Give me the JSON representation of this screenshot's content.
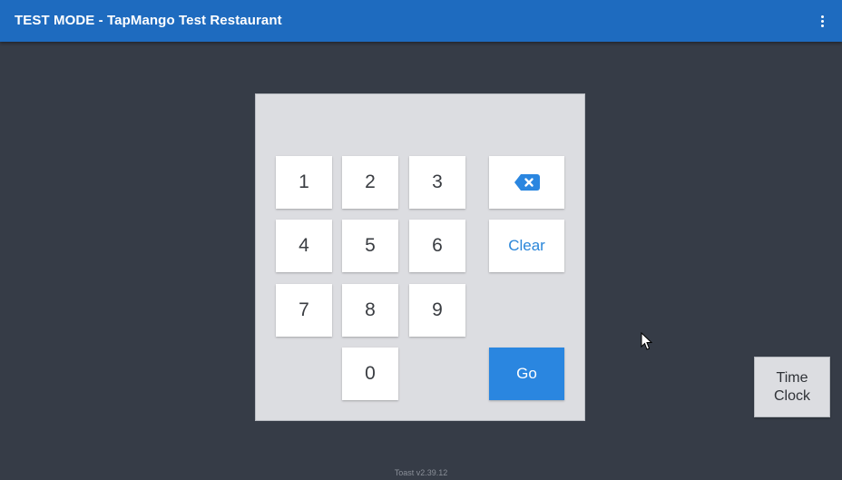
{
  "header": {
    "title": "TEST MODE - TapMango Test Restaurant",
    "menu_icon": "more-vert-icon"
  },
  "keypad": {
    "digits": [
      "1",
      "2",
      "3",
      "4",
      "5",
      "6",
      "7",
      "8",
      "9",
      "0"
    ],
    "backspace_icon": "backspace-icon",
    "clear_label": "Clear",
    "go_label": "Go"
  },
  "time_clock": {
    "label_line1": "Time",
    "label_line2": "Clock"
  },
  "footer": {
    "version": "Toast v2.39.12"
  },
  "colors": {
    "appbar": "#1e6bbf",
    "background": "#363c47",
    "accent": "#2a86e0",
    "pad": "#dcdde1"
  }
}
